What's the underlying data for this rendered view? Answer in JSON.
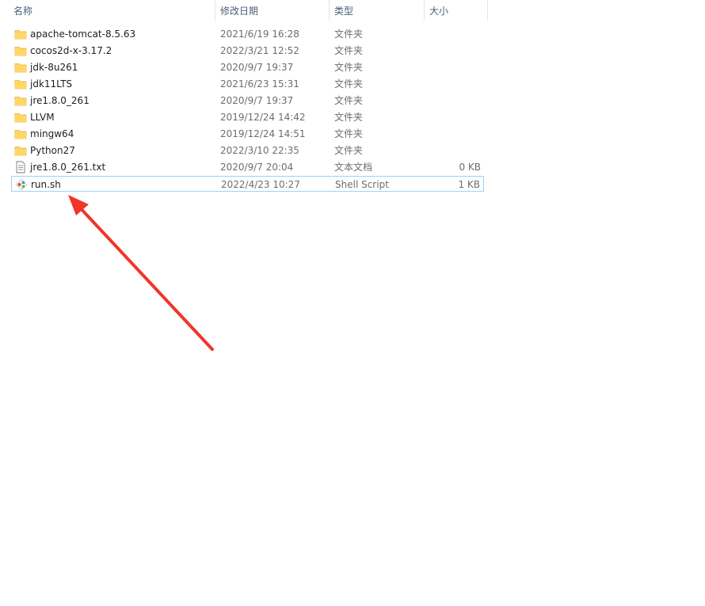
{
  "columns": {
    "name": "名称",
    "date": "修改日期",
    "type": "类型",
    "size": "大小",
    "sort_indicator": "^"
  },
  "files": [
    {
      "name": "apache-tomcat-8.5.63",
      "date": "2021/6/19 16:28",
      "type": "文件夹",
      "size": "",
      "icon": "folder-icon"
    },
    {
      "name": "cocos2d-x-3.17.2",
      "date": "2022/3/21 12:52",
      "type": "文件夹",
      "size": "",
      "icon": "folder-icon"
    },
    {
      "name": "jdk-8u261",
      "date": "2020/9/7 19:37",
      "type": "文件夹",
      "size": "",
      "icon": "folder-icon"
    },
    {
      "name": "jdk11LTS",
      "date": "2021/6/23 15:31",
      "type": "文件夹",
      "size": "",
      "icon": "folder-icon"
    },
    {
      "name": "jre1.8.0_261",
      "date": "2020/9/7 19:37",
      "type": "文件夹",
      "size": "",
      "icon": "folder-icon"
    },
    {
      "name": "LLVM",
      "date": "2019/12/24 14:42",
      "type": "文件夹",
      "size": "",
      "icon": "folder-icon"
    },
    {
      "name": "mingw64",
      "date": "2019/12/24 14:51",
      "type": "文件夹",
      "size": "",
      "icon": "folder-icon"
    },
    {
      "name": "Python27",
      "date": "2022/3/10 22:35",
      "type": "文件夹",
      "size": "",
      "icon": "folder-icon"
    },
    {
      "name": "jre1.8.0_261.txt",
      "date": "2020/9/7 20:04",
      "type": "文本文档",
      "size": "0 KB",
      "icon": "text-file-icon"
    },
    {
      "name": "run.sh",
      "date": "2022/4/23 10:27",
      "type": "Shell Script",
      "size": "1 KB",
      "icon": "git-script-icon",
      "selected": true
    }
  ],
  "colors": {
    "annotation_arrow": "#f0352a",
    "selection_border": "#99d1ff",
    "folder": "#ffd766"
  }
}
